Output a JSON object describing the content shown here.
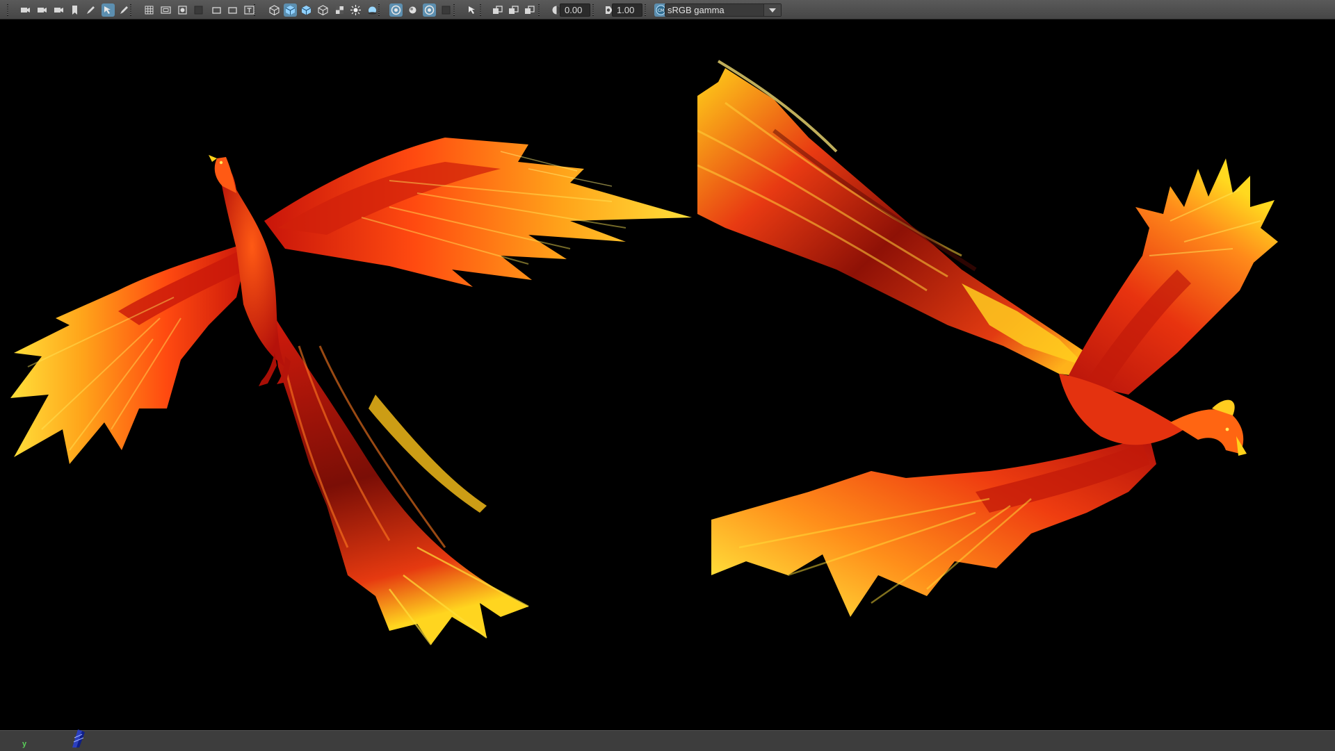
{
  "toolbar": {
    "buttons": [
      {
        "icon": "camera-icon"
      },
      {
        "icon": "camera-attributes-icon"
      },
      {
        "icon": "camera-bookmark-icon"
      },
      {
        "icon": "bookmark-icon"
      },
      {
        "icon": "image-plane-icon"
      },
      {
        "icon": "two-d-pan-zoom-icon",
        "active": true
      },
      {
        "icon": "grease-pencil-icon"
      },
      {
        "icon": "grid-icon"
      },
      {
        "icon": "film-gate-icon"
      },
      {
        "icon": "resolution-gate-icon"
      },
      {
        "icon": "gate-mask-icon"
      },
      {
        "icon": "field-chart-icon"
      },
      {
        "icon": "safe-action-icon"
      },
      {
        "icon": "safe-title-icon"
      },
      {
        "icon": "wireframe-icon"
      },
      {
        "icon": "smooth-shade-icon",
        "active": true
      },
      {
        "icon": "default-material-icon"
      },
      {
        "icon": "wireframe-on-shaded-icon"
      },
      {
        "icon": "textured-icon"
      },
      {
        "icon": "use-all-lights-icon"
      },
      {
        "icon": "shadows-icon"
      },
      {
        "icon": "screen-space-ao-icon",
        "active": true
      },
      {
        "icon": "motion-blur-icon"
      },
      {
        "icon": "anti-aliasing-icon",
        "active": true
      },
      {
        "icon": "depth-of-field-icon"
      },
      {
        "icon": "isolate-select-icon"
      },
      {
        "icon": "xray-icon"
      },
      {
        "icon": "xray-active-components-icon"
      },
      {
        "icon": "xray-joints-icon"
      },
      {
        "icon": "exposure-icon"
      },
      {
        "icon": "gamma-icon"
      },
      {
        "icon": "color-management-icon",
        "active": true
      }
    ],
    "exposure_value": "0.00",
    "gamma_value": "1.00",
    "view_transform": "sRGB gamma"
  },
  "viewport": {
    "left_render": "phoenix-top-view",
    "right_render": "phoenix-side-view"
  },
  "status": {
    "axis_label": "y"
  },
  "colors": {
    "toolbar_bg": "#4e4e4e",
    "active_button": "#5c8fb0",
    "viewport_bg": "#000000",
    "feather_yellow": "#ffd21a",
    "feather_orange": "#ff6a12",
    "feather_red": "#c8150a"
  }
}
